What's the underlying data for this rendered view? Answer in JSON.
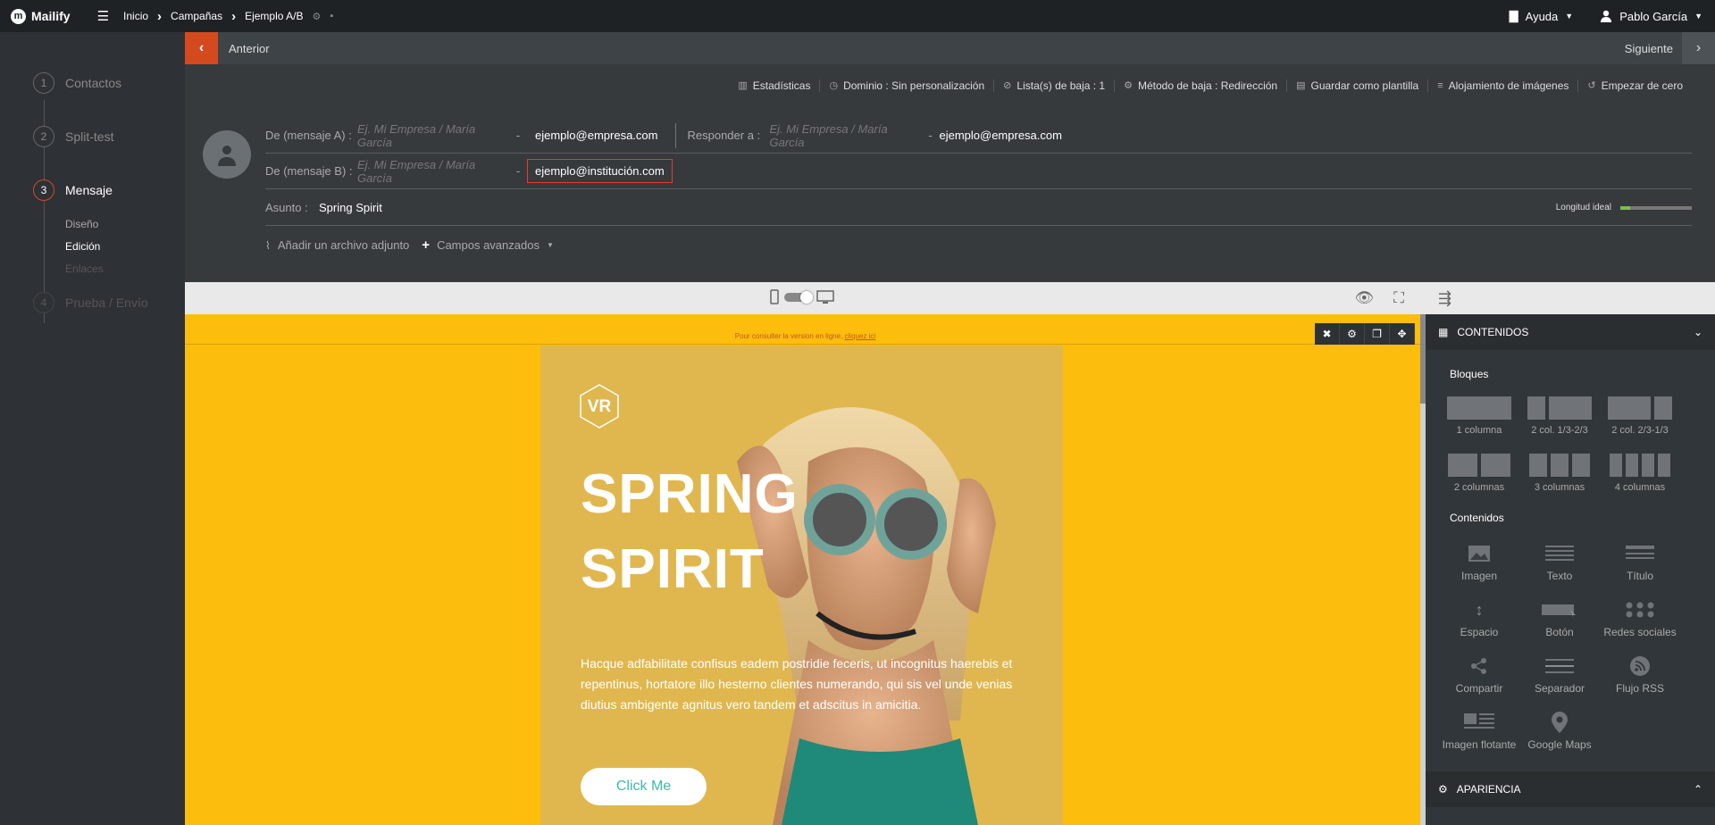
{
  "app": {
    "name": "Mailify",
    "logo_letter": "m"
  },
  "breadcrumbs": [
    "Inicio",
    "Campañas",
    "Ejemplo A/B"
  ],
  "topbar": {
    "help": "Ayuda",
    "user": "Pablo García"
  },
  "steps": [
    {
      "num": "1",
      "label": "Contactos"
    },
    {
      "num": "2",
      "label": "Split-test"
    },
    {
      "num": "3",
      "label": "Mensaje"
    },
    {
      "num": "4",
      "label": "Prueba / Envío"
    }
  ],
  "substeps": [
    "Diseño",
    "Edición",
    "Enlaces"
  ],
  "nav": {
    "prev": "Anterior",
    "next": "Siguiente"
  },
  "settings": [
    {
      "icon": "stats-icon",
      "label": "Estadísticas"
    },
    {
      "icon": "clock-icon",
      "label": "Dominio : Sin personalización"
    },
    {
      "icon": "ban-icon",
      "label": "Lista(s) de baja : 1"
    },
    {
      "icon": "gear-icon",
      "label": "Método de baja : Redirección"
    },
    {
      "icon": "save-template-icon",
      "label": "Guardar como plantilla"
    },
    {
      "icon": "database-icon",
      "label": "Alojamiento de imágenes"
    },
    {
      "icon": "history-icon",
      "label": "Empezar de cero"
    }
  ],
  "form": {
    "from_a_label": "De (mensaje A) :",
    "from_a_placeholder": "Ej. Mi Empresa / María García",
    "from_a_email": "ejemplo@empresa.com",
    "reply_label": "Responder a :",
    "reply_placeholder": "Ej. Mi Empresa / María García",
    "reply_email": "ejemplo@empresa.com",
    "from_b_label": "De (mensaje B) :",
    "from_b_placeholder": "Ej. Mi Empresa / María García",
    "from_b_email": "ejemplo@institución.com",
    "subject_label": "Asunto :",
    "subject_value": "Spring Spirit",
    "length_label": "Longitud ideal",
    "length_fraction": 0.14,
    "dash": "-",
    "attach": "Añadir un archivo adjunto",
    "advanced": "Campos avanzados"
  },
  "email": {
    "online_text": "Pour consulter la version en ligne, ",
    "online_link": "cliquez ici",
    "logo": "VR",
    "title_line1": "SPRING",
    "title_line2": "SPIRIT",
    "body": "Hacque adfabilitate confisus eadem postridie feceris, ut incognitus haerebis et repentinus, hortatore illo hesterno clientes numerando, qui sis vel unde venias diutius ambigente agnitus vero tandem et adscitus in amicitia.",
    "button": "Click Me",
    "bg_color": "#fdbd0c",
    "button_text_color": "#3fb9a8"
  },
  "panel": {
    "contents_title": "CONTENIDOS",
    "blocks_title": "Bloques",
    "blocks": [
      "1 columna",
      "2 col. 1/3-2/3",
      "2 col. 2/3-1/3",
      "2 columnas",
      "3 columnas",
      "4 columnas"
    ],
    "contents_section": "Contenidos",
    "contents": [
      "Imagen",
      "Texto",
      "Título",
      "Espacio",
      "Botón",
      "Redes sociales",
      "Compartir",
      "Separador",
      "Flujo RSS",
      "Imagen flotante",
      "Google Maps"
    ],
    "appearance_title": "APARIENCIA"
  },
  "colors": {
    "accent": "#d5491f",
    "error_border": "#e03c3c",
    "length_ok": "#7ac142"
  }
}
